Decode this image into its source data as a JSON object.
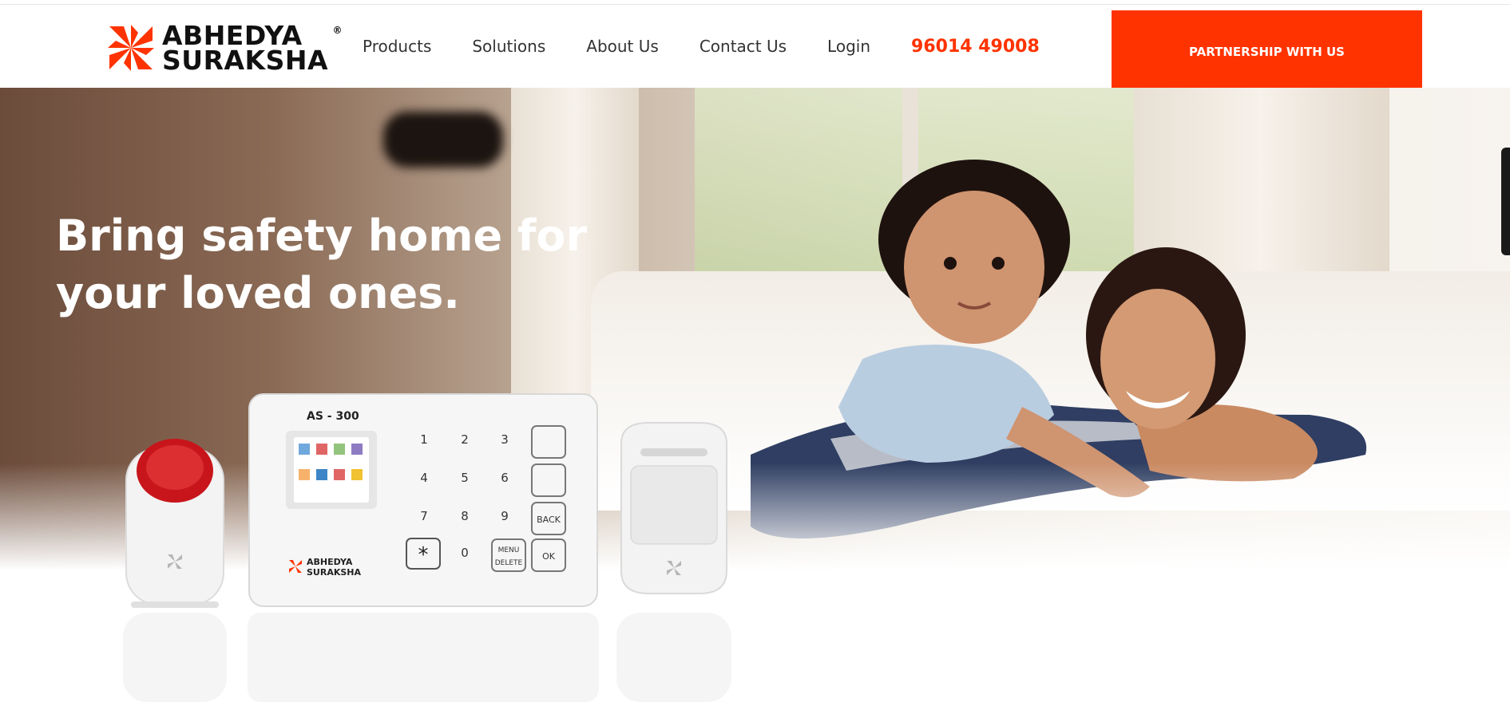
{
  "brand": {
    "name_line1": "ABHEDYA",
    "name_line2": "SURAKSHA",
    "registered": "®",
    "accent": "#ff3300"
  },
  "nav": {
    "items": [
      {
        "label": "Products"
      },
      {
        "label": "Solutions"
      },
      {
        "label": "About Us"
      },
      {
        "label": "Contact Us"
      },
      {
        "label": "Login"
      }
    ],
    "phone": "96014 49008"
  },
  "cta": {
    "label": "PARTNERSHIP WITH US",
    "color": "#ff3300"
  },
  "hero": {
    "headline_line1": "Bring safety home for",
    "headline_line2": "your loved ones."
  },
  "product": {
    "model": "AS - 300",
    "keypad": [
      "1",
      "2",
      "3",
      "4",
      "5",
      "6",
      "7",
      "8",
      "9",
      "0"
    ],
    "key_back": "BACK",
    "key_menu": "MENU",
    "key_delete": "DELETE",
    "key_ok": "OK",
    "brand_line1": "ABHEDYA",
    "brand_line2": "SURAKSHA"
  }
}
